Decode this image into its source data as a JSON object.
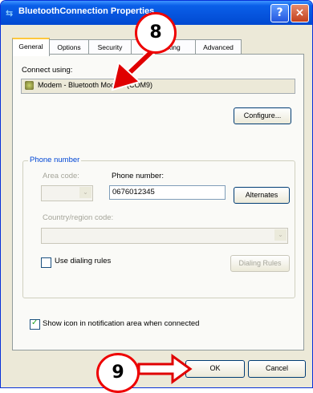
{
  "window": {
    "title": "BluetoothConnection Properties",
    "help_glyph": "?",
    "close_glyph": "×"
  },
  "tabs": [
    {
      "label": "General"
    },
    {
      "label": "Options"
    },
    {
      "label": "Security"
    },
    {
      "label": "Networking"
    },
    {
      "label": "Advanced"
    }
  ],
  "general": {
    "connect_using_label": "Connect using:",
    "device_name": "Modem - Bluetooth Modem (COM9)",
    "configure_label": "Configure..."
  },
  "phone": {
    "group_label": "Phone number",
    "area_code_label": "Area code:",
    "area_code_value": "",
    "phone_number_label": "Phone number:",
    "phone_number_value": "0676012345",
    "alternates_label": "Alternates",
    "country_label": "Country/region code:",
    "country_value": "",
    "dropdown_glyph": "⌄",
    "use_dialing_rules_label": "Use dialing rules",
    "use_dialing_rules_checked": false,
    "dialing_rules_label": "Dialing Rules"
  },
  "show_icon": {
    "label": "Show icon in notification area when connected",
    "checked": true,
    "check_glyph": "✓"
  },
  "buttons": {
    "ok": "OK",
    "cancel": "Cancel"
  },
  "annotations": [
    {
      "label": "8"
    },
    {
      "label": "9"
    }
  ],
  "colors": {
    "callout_border": "#e00000",
    "titlebar": "#0654dd",
    "group_legend": "#0046d5"
  }
}
